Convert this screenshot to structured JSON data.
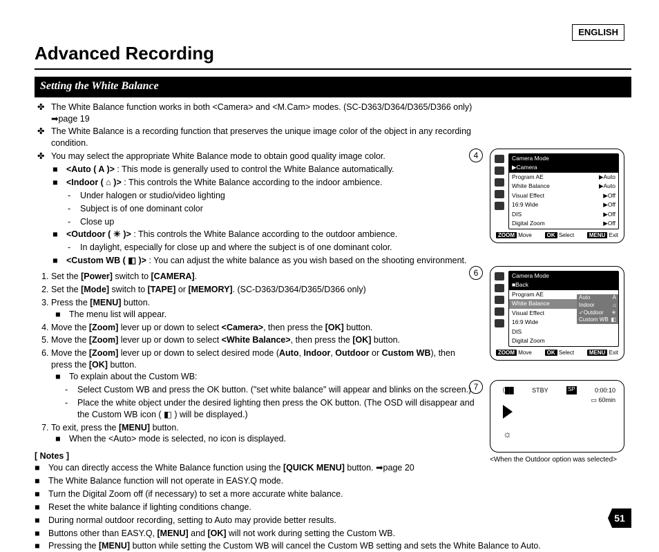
{
  "language_tag": "ENGLISH",
  "page_title": "Advanced Recording",
  "section_title": "Setting the White Balance",
  "page_number": "51",
  "intro": [
    "The White Balance function works in both <Camera> and <M.Cam> modes. (SC-D363/D364/D365/D366 only) ➡page 19",
    "The White Balance is a recording function that preserves the unique image color of the object in any recording condition.",
    "You may select the appropriate White Balance mode to obtain good quality image color."
  ],
  "modes": [
    {
      "name": "<Auto ( A )>",
      "desc": " : This mode is generally used to control the White Balance automatically."
    },
    {
      "name": "<Indoor ( ⌂ )>",
      "desc": " : This controls the White Balance according to the indoor ambience.",
      "sub": [
        "Under halogen or studio/video lighting",
        "Subject is of one dominant color",
        "Close up"
      ]
    },
    {
      "name": "<Outdoor ( ☀ )>",
      "desc": " : This controls the White Balance according to the outdoor ambience.",
      "sub": [
        "In daylight, especially for close up and where the subject is of one dominant color."
      ]
    },
    {
      "name": "<Custom WB ( ◧ )>",
      "desc": " : You can adjust the white balance as you wish based on the shooting environment."
    }
  ],
  "steps": [
    "Set the [Power] switch to [CAMERA].",
    "Set the [Mode] switch to [TAPE] or [MEMORY]. (SC-D363/D364/D365/D366 only)",
    "Press the [MENU] button.",
    "Move the [Zoom] lever up or down to select <Camera>, then press the [OK] button.",
    "Move the [Zoom] lever up or down to select <White Balance>, then press the [OK] button.",
    "Move the [Zoom] lever up or down to select desired mode (Auto, Indoor, Outdoor or Custom WB), then press the [OK] button.",
    "To exit, press the [MENU] button."
  ],
  "step3_sub": "The menu list will appear.",
  "step6_sub_title": "To explain about the Custom WB:",
  "step6_subs": [
    "Select Custom WB and press the OK button. (\"set white balance\" will appear and blinks on the screen.)",
    "Place the white object under the desired lighting then press the OK button. (The OSD will disappear and the Custom WB icon ( ◧ ) will be displayed.)"
  ],
  "step7_sub": "When the <Auto> mode is selected, no icon is displayed.",
  "notes_title": "[ Notes ]",
  "notes": [
    "You can directly access the White Balance function using the [QUICK MENU] button. ➡page 20",
    "The White Balance function will not operate in EASY.Q mode.",
    "Turn the Digital Zoom off (if necessary) to set a more accurate white balance.",
    "Reset the white balance if lighting conditions change.",
    "During normal outdoor recording, setting to Auto may provide better results.",
    "Buttons other than EASY.Q, [MENU] and [OK] will not work during setting the Custom WB.",
    "Pressing the [MENU] button while setting the Custom WB will cancel the Custom WB setting and sets the White Balance to Auto."
  ],
  "osd4": {
    "title": "Camera Mode",
    "selected": "▶Camera",
    "rows": [
      {
        "l": "Program AE",
        "r": "▶Auto"
      },
      {
        "l": "White Balance",
        "r": "▶Auto"
      },
      {
        "l": "Visual Effect",
        "r": "▶Off"
      },
      {
        "l": "16:9 Wide",
        "r": "▶Off"
      },
      {
        "l": "DIS",
        "r": "▶Off"
      },
      {
        "l": "Digital Zoom",
        "r": "▶Off"
      }
    ],
    "footer": {
      "zoom": "ZOOM",
      "move": "Move",
      "ok": "OK",
      "select": "Select",
      "menu": "MENU",
      "exit": "Exit"
    }
  },
  "osd6": {
    "title": "Camera Mode",
    "back": "■Back",
    "rows": [
      "Program AE",
      "White Balance",
      "Visual Effect",
      "16:9 Wide",
      "DIS",
      "Digital Zoom"
    ],
    "submenu": [
      "Auto",
      "Indoor",
      "Outdoor",
      "Custom WB"
    ],
    "submenu_sel": "Outdoor",
    "footer": {
      "zoom": "ZOOM",
      "move": "Move",
      "ok": "OK",
      "select": "Select",
      "menu": "MENU",
      "exit": "Exit"
    }
  },
  "osd7": {
    "stby": "STBY",
    "sp": "SP",
    "time": "0:00:10",
    "remain": "60min",
    "caption": "<When the Outdoor option was selected>"
  },
  "circles": {
    "c4": "4",
    "c6": "6",
    "c7": "7"
  }
}
